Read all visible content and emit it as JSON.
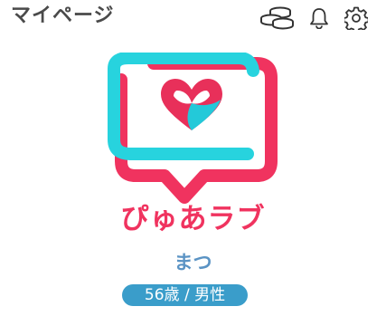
{
  "header": {
    "title": "マイページ",
    "icons": [
      "coins-icon",
      "bell-icon",
      "gear-icon"
    ]
  },
  "logo": {
    "text": "ぴゅあラブ",
    "colors": {
      "cyan": "#27d3de",
      "pink": "#f0335f",
      "heart_red": "#e8305a",
      "heart_cyan": "#23c9d9"
    }
  },
  "profile": {
    "name": "まつ",
    "details": "56歳 / 男性",
    "badge_color": "#3a9dca"
  }
}
